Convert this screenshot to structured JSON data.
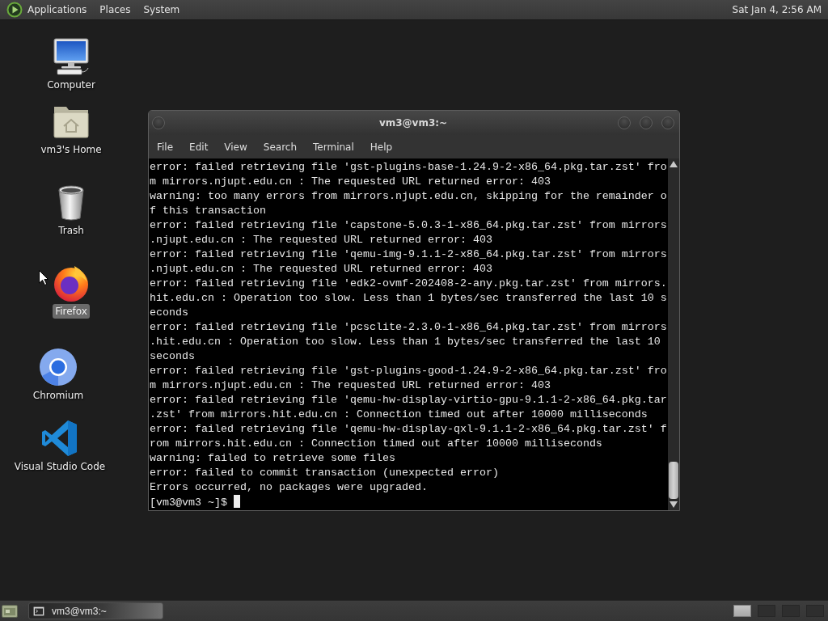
{
  "top_panel": {
    "menus": [
      "Applications",
      "Places",
      "System"
    ],
    "clock": "Sat Jan 4, 2:56 AM"
  },
  "desktop_icons": [
    {
      "kind": "computer",
      "label": "Computer",
      "selected": false
    },
    {
      "kind": "home",
      "label": "vm3's Home",
      "selected": false
    },
    {
      "kind": "trash",
      "label": "Trash",
      "selected": false
    },
    {
      "kind": "browser_fox",
      "label": "Firefox",
      "selected": true
    },
    {
      "kind": "browser_ring",
      "label": "Chromium",
      "selected": false
    },
    {
      "kind": "code_editor",
      "label": "Visual Studio Code",
      "selected": false
    }
  ],
  "terminal_window": {
    "title": "vm3@vm3:~",
    "menu": [
      "File",
      "Edit",
      "View",
      "Search",
      "Terminal",
      "Help"
    ],
    "output": [
      "error: failed retrieving file 'gst-plugins-base-1.24.9-2-x86_64.pkg.tar.zst' from mirrors.njupt.edu.cn : The requested URL returned error: 403",
      "warning: too many errors from mirrors.njupt.edu.cn, skipping for the remainder of this transaction",
      "error: failed retrieving file 'capstone-5.0.3-1-x86_64.pkg.tar.zst' from mirrors.njupt.edu.cn : The requested URL returned error: 403",
      "error: failed retrieving file 'qemu-img-9.1.1-2-x86_64.pkg.tar.zst' from mirrors.njupt.edu.cn : The requested URL returned error: 403",
      "error: failed retrieving file 'edk2-ovmf-202408-2-any.pkg.tar.zst' from mirrors.hit.edu.cn : Operation too slow. Less than 1 bytes/sec transferred the last 10 seconds",
      "error: failed retrieving file 'pcsclite-2.3.0-1-x86_64.pkg.tar.zst' from mirrors.hit.edu.cn : Operation too slow. Less than 1 bytes/sec transferred the last 10 seconds",
      "error: failed retrieving file 'gst-plugins-good-1.24.9-2-x86_64.pkg.tar.zst' from mirrors.njupt.edu.cn : The requested URL returned error: 403",
      "error: failed retrieving file 'qemu-hw-display-virtio-gpu-9.1.1-2-x86_64.pkg.tar.zst' from mirrors.hit.edu.cn : Connection timed out after 10000 milliseconds",
      "error: failed retrieving file 'qemu-hw-display-qxl-9.1.1-2-x86_64.pkg.tar.zst' from mirrors.hit.edu.cn : Connection timed out after 10000 milliseconds",
      "warning: failed to retrieve some files",
      "error: failed to commit transaction (unexpected error)",
      "Errors occurred, no packages were upgraded."
    ],
    "prompt": "[vm3@vm3 ~]$"
  },
  "bottom_panel": {
    "tasks": [
      {
        "title": "vm3@vm3:~",
        "selected": true
      }
    ],
    "workspaces": [
      {
        "selected": true
      },
      {
        "selected": false
      },
      {
        "selected": false
      },
      {
        "selected": false
      }
    ]
  }
}
